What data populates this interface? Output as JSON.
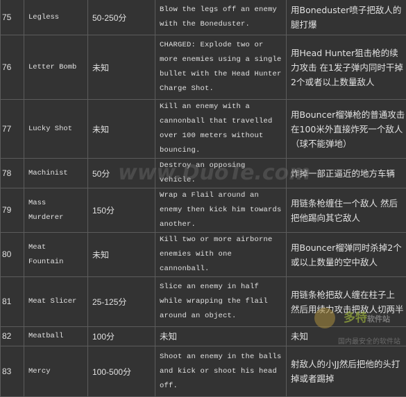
{
  "rows": [
    {
      "num": "75",
      "name": "Legless",
      "points": "50-250分",
      "desc": "Blow the legs off an enemy with the Boneduster.",
      "cn": "用Boneduster喷子把敌人的腿打爆"
    },
    {
      "num": "76",
      "name": "Letter Bomb",
      "points": "未知",
      "desc": "CHARGED: Explode two or more enemies using a single bullet with the Head Hunter Charge Shot.",
      "cn": "用Head Hunter狙击枪的续力攻击 在1发子弹内同时干掉2个或者以上数量敌人"
    },
    {
      "num": "77",
      "name": "Lucky Shot",
      "points": "未知",
      "desc": "Kill an enemy with a cannonball that travelled over 100 meters without bouncing.",
      "cn": "用Bouncer榴弹枪的普通攻击在100米外直接炸死一个敌人（球不能弹地）"
    },
    {
      "num": "78",
      "name": "Machinist",
      "points": "50分",
      "desc": "Destroy an opposing vehicle.",
      "cn": "炸掉一部正逼近的地方车辆"
    },
    {
      "num": "79",
      "name": "Mass Murderer",
      "points": "150分",
      "desc": "Wrap a Flail around an enemy then kick him towards another.",
      "cn": "用链条枪缠住一个敌人 然后把他踢向其它敌人"
    },
    {
      "num": "80",
      "name": "Meat Fountain",
      "points": "未知",
      "desc": "Kill two or more airborne enemies with one cannonball.",
      "cn": "用Bouncer榴弹同时杀掉2个或以上数量的空中敌人"
    },
    {
      "num": "81",
      "name": "Meat Slicer",
      "points": "25-125分",
      "desc": "Slice an enemy in half while wrapping the flail around an object.",
      "cn": "用链条枪把敌人缠在柱子上 然后用续力攻击把敌人切两半"
    },
    {
      "num": "82",
      "name": "Meatball",
      "points": "100分",
      "desc": "未知",
      "cn": "未知"
    },
    {
      "num": "83",
      "name": "Mercy",
      "points": "100-500分",
      "desc": "Shoot an enemy in the balls and kick or shoot his head off.",
      "cn": "射敌人的小JJ然后把他的头打掉或者踢掉"
    }
  ],
  "watermark": {
    "site": "www.DuoTe.com",
    "logo_main": "多特",
    "logo_sub": "软件站",
    "logo_slogan": "国内最安全的软件站"
  },
  "colors": {
    "background": "#333333",
    "border": "#5c5c5c",
    "text": "#e2e2e2"
  }
}
